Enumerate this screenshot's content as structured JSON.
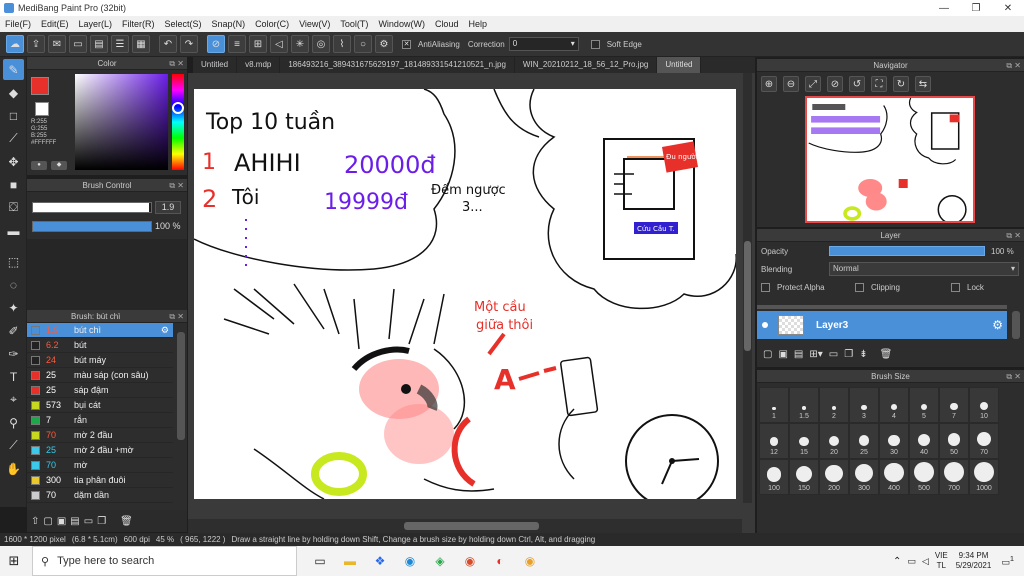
{
  "window": {
    "title": "MediBang Paint Pro (32bit)",
    "min": "—",
    "restore": "❐",
    "close": "✕"
  },
  "menu": [
    "File(F)",
    "Edit(E)",
    "Layer(L)",
    "Filter(R)",
    "Select(S)",
    "Snap(N)",
    "Color(C)",
    "View(V)",
    "Tool(T)",
    "Window(W)",
    "Cloud",
    "Help"
  ],
  "toolbar": {
    "antialiasing": "AntiAliasing",
    "correction_label": "Correction",
    "correction_value": "0",
    "soft_edge": "Soft Edge"
  },
  "color_panel": {
    "title": "Color",
    "r": "R:255",
    "g": "G:255",
    "b": "B:255",
    "hex": "#FFFFFF",
    "fg": "#e8302a",
    "bg": "#ffffff"
  },
  "brush_control": {
    "title": "Brush Control",
    "size": "1.9",
    "opacity": "100 %",
    "size_fill": 0.98,
    "opacity_fill": 1.0
  },
  "brush_list": {
    "title": "Brush: bút chì",
    "items": [
      {
        "size": "1.9",
        "name": "bút chì",
        "color": "#4a90d9",
        "size_color": "#ff5a3c"
      },
      {
        "size": "6.2",
        "name": "bút",
        "color": "#222222",
        "size_color": "#ff5a3c"
      },
      {
        "size": "24",
        "name": "bút máy",
        "color": "#222222",
        "size_color": "#ff5a3c"
      },
      {
        "size": "25",
        "name": "màu sáp (con sâu)",
        "color": "#e8302a",
        "size_color": "#ffffff"
      },
      {
        "size": "25",
        "name": "sáp đậm",
        "color": "#e8302a",
        "size_color": "#ffffff"
      },
      {
        "size": "573",
        "name": "bụi cát",
        "color": "#c8d820",
        "size_color": "#ffffff"
      },
      {
        "size": "7",
        "name": "rắn",
        "color": "#1aa84a",
        "size_color": "#ffffff"
      },
      {
        "size": "70",
        "name": "mờ 2 đầu",
        "color": "#c8d820",
        "size_color": "#ff5a3c"
      },
      {
        "size": "25",
        "name": "mờ 2 đầu +mờ",
        "color": "#3cc8e8",
        "size_color": "#3cc8e8"
      },
      {
        "size": "70",
        "name": "mờ",
        "color": "#3cc8e8",
        "size_color": "#3cc8e8"
      },
      {
        "size": "300",
        "name": "tia phân đuôi",
        "color": "#e8c82a",
        "size_color": "#ffffff"
      },
      {
        "size": "70",
        "name": "dặm dần",
        "color": "#cccccc",
        "size_color": "#ffffff"
      }
    ]
  },
  "tabs": [
    "Untitled",
    "v8.mdp",
    "186493216_389431675629197_181489331541210521_n.jpg",
    "WIN_20210212_18_56_12_Pro.jpg",
    "Untitled"
  ],
  "canvas_text": {
    "title": "Top 10 tuần",
    "n1": "1",
    "name1": "AHIHI",
    "score1": "20000đ",
    "n2": "2",
    "name2": "Tôi",
    "score2": "19999đ",
    "countdown": "Đếm ngược",
    "countdown_num": "3...",
    "sticker": "Đu người",
    "button": "Cứu Cầu T.",
    "note1": "Một cầu",
    "note2": "giữa thôi",
    "letter": "A"
  },
  "navigator": {
    "title": "Navigator"
  },
  "layer_panel": {
    "title": "Layer",
    "opacity_label": "Opacity",
    "opacity_value": "100 %",
    "blending_label": "Blending",
    "blending_value": "Normal",
    "protect_alpha": "Protect Alpha",
    "clipping": "Clipping",
    "lock": "Lock",
    "layer_name": "Layer3"
  },
  "brush_size": {
    "title": "Brush Size",
    "sizes": [
      "1",
      "1.5",
      "2",
      "3",
      "4",
      "5",
      "7",
      "10",
      "12",
      "15",
      "20",
      "25",
      "30",
      "40",
      "50",
      "70",
      "100",
      "150",
      "200",
      "300",
      "400",
      "500",
      "700",
      "1000"
    ]
  },
  "status": {
    "pixels": "1600 * 1200 pixel",
    "cm": "(6.8 * 5.1cm)",
    "dpi": "600 dpi",
    "zoom": "45 %",
    "coords": "( 965, 1222 )",
    "hint": "Draw a straight line by holding down Shift, Change a brush size by holding down Ctrl, Alt, and dragging"
  },
  "taskbar": {
    "search": "Type here to search",
    "lang1": "VIE",
    "lang2": "TL",
    "time": "9:34 PM",
    "date": "5/29/2021",
    "notif": "1"
  }
}
